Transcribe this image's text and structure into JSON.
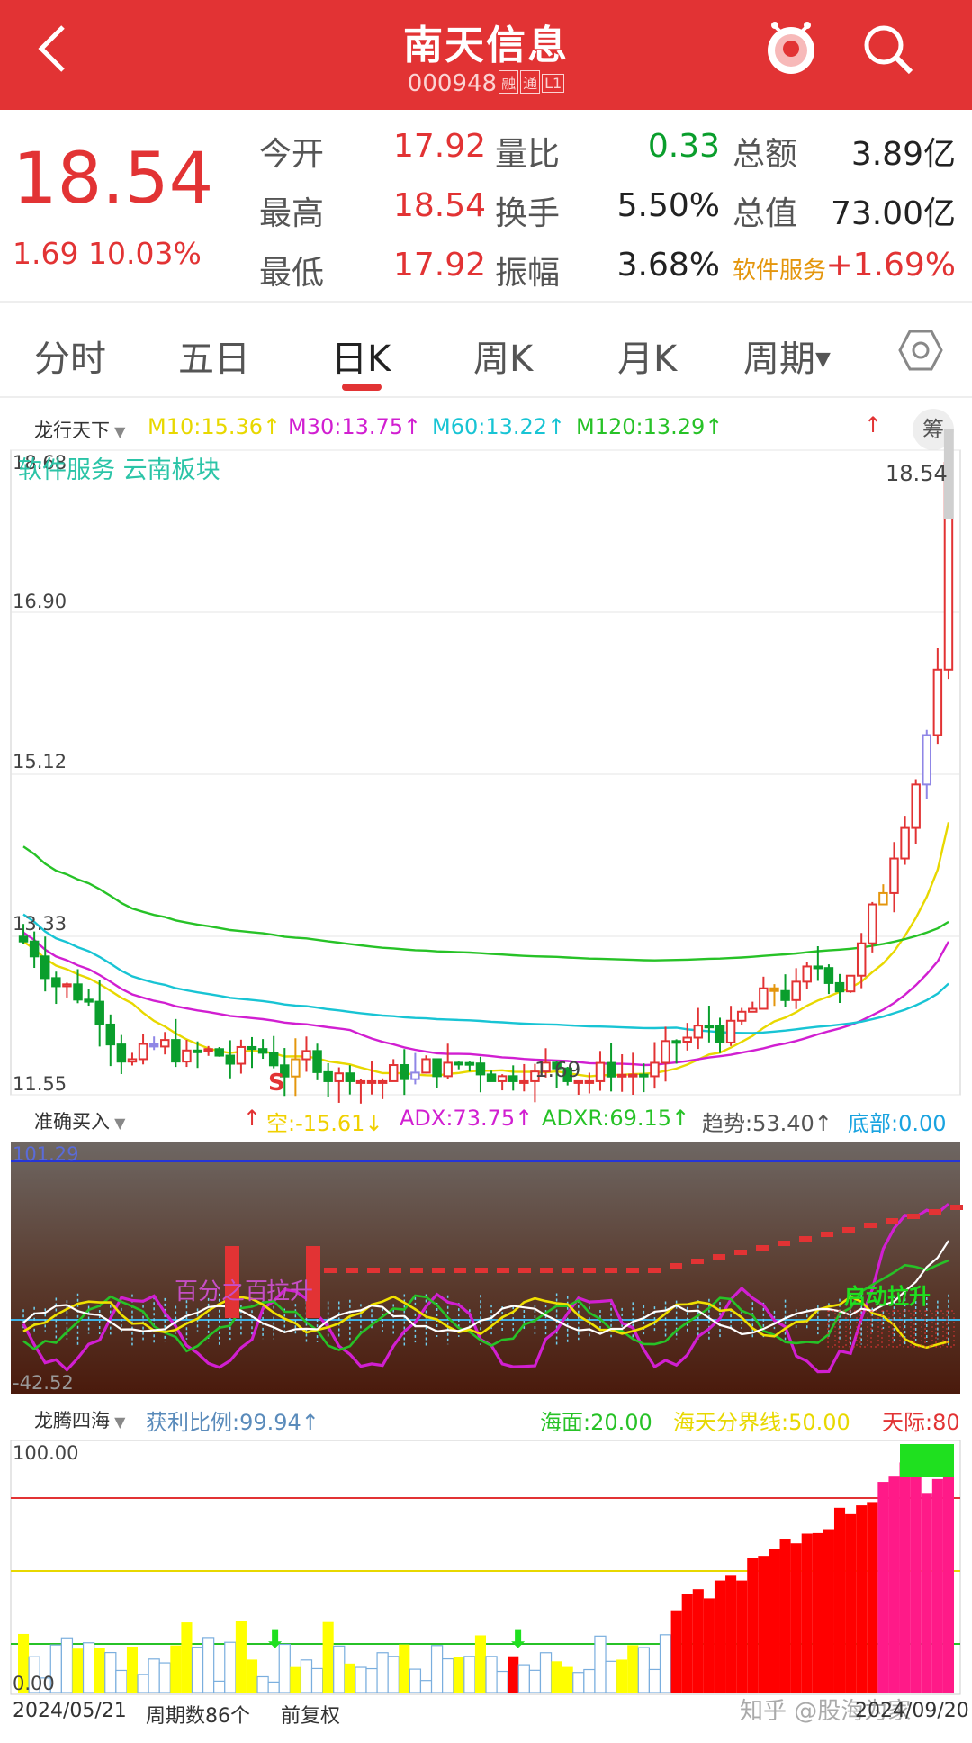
{
  "header": {
    "title": "南天信息",
    "code": "000948",
    "tags": [
      "融",
      "通",
      "L1"
    ]
  },
  "quote": {
    "price": "18.54",
    "change": "1.69",
    "change_pct": "10.03%",
    "rows": [
      {
        "l1": "今开",
        "v1": "17.92",
        "l2": "量比",
        "v2": "0.33",
        "l3": "总额",
        "v3": "3.89亿"
      },
      {
        "l1": "最高",
        "v1": "18.54",
        "l2": "换手",
        "v2": "5.50%",
        "l3": "总值",
        "v3": "73.00亿"
      },
      {
        "l1": "最低",
        "v1": "17.92",
        "l2": "振幅",
        "v2": "3.68%",
        "l3": "软件服务",
        "v3": "+1.69%"
      }
    ]
  },
  "tabs": [
    "分时",
    "五日",
    "日K",
    "周K",
    "月K",
    "周期"
  ],
  "main_chart": {
    "indicator": "龙行天下",
    "ma": [
      "M10:15.36↑",
      "M30:13.75↑",
      "M60:13.22↑",
      "M120:13.29↑"
    ],
    "ma_colors": [
      "#e8d800",
      "#d11fd1",
      "#18c4d4",
      "#27c227"
    ],
    "chou": "筹",
    "board_label": "软件服务 云南板块",
    "y_ticks": [
      "18.68",
      "16.90",
      "15.12",
      "13.33",
      "11.55"
    ],
    "last_price": "18.54",
    "low_label": "1.69",
    "s_marker": "S",
    "y_range": [
      11.55,
      18.68
    ]
  },
  "sub1": {
    "indicator": "准确买入",
    "values": [
      "空:-15.61↓",
      "ADX:73.75↑",
      "ADXR:69.15↑",
      "趋势:53.40↑",
      "底部:0.00"
    ],
    "value_colors": [
      "#f0d000",
      "#d11fd1",
      "#27c227",
      "#555555",
      "#19a3e0"
    ],
    "y_top": "101.29",
    "y_bottom": "-42.52",
    "ann1": "百分之百",
    "ann2": "拉升",
    "ann3": "启动拉升"
  },
  "sub2": {
    "indicator": "龙腾四海",
    "ratio": "获利比例:99.94↑",
    "right": [
      "海面:20.00",
      "海天分界线:50.00",
      "天际:80"
    ],
    "right_colors": [
      "#27c227",
      "#e8d800",
      "#e23334"
    ],
    "y_top": "100.00",
    "y_bottom": "0.00"
  },
  "footer": {
    "start_date": "2024/05/21",
    "count": "周期数86个",
    "adjust": "前复权",
    "end_date": "2024/09/20",
    "watermark": "知乎 @股海为家"
  },
  "colors": {
    "brand": "#e23334",
    "up": "#e23334",
    "down": "#0a9e2c"
  }
}
